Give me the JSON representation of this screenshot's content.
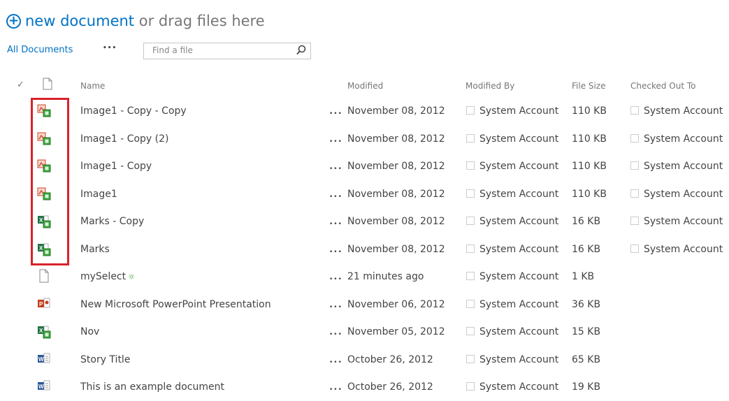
{
  "upload": {
    "link_text": "new document",
    "rest_text": " or drag files here",
    "plus_icon": "add-circle-icon"
  },
  "toolbar": {
    "view_label": "All Documents",
    "more_label": "•••",
    "search_placeholder": "Find a file",
    "search_icon": "magnifier-icon"
  },
  "columns": {
    "select": "✓",
    "type_icon": "document-icon",
    "name": "Name",
    "modified": "Modified",
    "modified_by": "Modified By",
    "file_size": "File Size",
    "checked_out_to": "Checked Out To"
  },
  "rows": [
    {
      "icon": "image-file-icon",
      "name": "Image1 - Copy - Copy",
      "dots": "•••",
      "modified": "November 08, 2012",
      "modified_by": "System Account",
      "size": "110 KB",
      "checked_out_to": "System Account"
    },
    {
      "icon": "image-file-icon",
      "name": "Image1 - Copy (2)",
      "dots": "•••",
      "modified": "November 08, 2012",
      "modified_by": "System Account",
      "size": "110 KB",
      "checked_out_to": "System Account"
    },
    {
      "icon": "image-file-icon",
      "name": "Image1 - Copy",
      "dots": "•••",
      "modified": "November 08, 2012",
      "modified_by": "System Account",
      "size": "110 KB",
      "checked_out_to": "System Account"
    },
    {
      "icon": "image-file-icon",
      "name": "Image1",
      "dots": "•••",
      "modified": "November 08, 2012",
      "modified_by": "System Account",
      "size": "110 KB",
      "checked_out_to": "System Account"
    },
    {
      "icon": "excel-file-icon",
      "name": "Marks - Copy",
      "dots": "•••",
      "modified": "November 08, 2012",
      "modified_by": "System Account",
      "size": "16 KB",
      "checked_out_to": "System Account"
    },
    {
      "icon": "excel-file-icon",
      "name": "Marks",
      "dots": "•••",
      "modified": "November 08, 2012",
      "modified_by": "System Account",
      "size": "16 KB",
      "checked_out_to": "System Account"
    },
    {
      "icon": "blank-file-icon",
      "name": "mySelect",
      "new_badge": "☼",
      "dots": "•••",
      "modified": "21 minutes ago",
      "modified_by": "System Account",
      "size": "1 KB",
      "checked_out_to": ""
    },
    {
      "icon": "powerpoint-file-icon",
      "name": "New Microsoft PowerPoint Presentation",
      "dots": "•••",
      "modified": "November 06, 2012",
      "modified_by": "System Account",
      "size": "36 KB",
      "checked_out_to": ""
    },
    {
      "icon": "excel-file-icon",
      "name": "Nov",
      "dots": "•••",
      "modified": "November 05, 2012",
      "modified_by": "System Account",
      "size": "15 KB",
      "checked_out_to": ""
    },
    {
      "icon": "word-file-icon",
      "name": "Story Title",
      "dots": "•••",
      "modified": "October 26, 2012",
      "modified_by": "System Account",
      "size": "65 KB",
      "checked_out_to": ""
    },
    {
      "icon": "word-file-icon",
      "name": "This is an example document",
      "dots": "•••",
      "modified": "October 26, 2012",
      "modified_by": "System Account",
      "size": "19 KB",
      "checked_out_to": ""
    }
  ],
  "colors": {
    "link": "#0072c6",
    "highlight": "#d9222a",
    "image_icon": "#d24726",
    "excel_icon": "#217346",
    "ppt_icon": "#c43e1c",
    "word_icon": "#2b579a"
  }
}
